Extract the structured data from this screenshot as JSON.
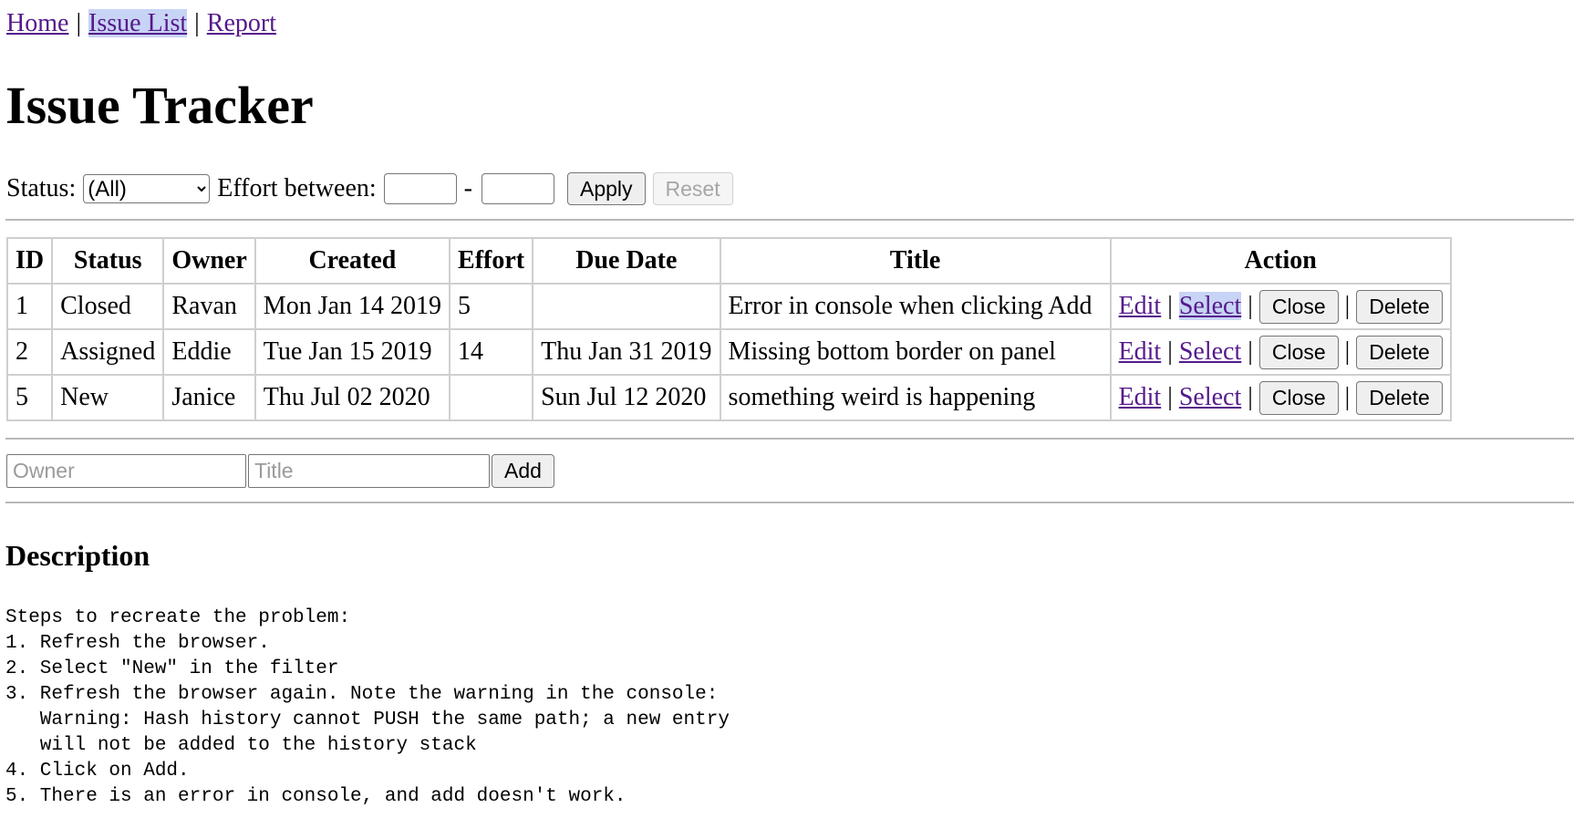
{
  "nav": {
    "home": "Home",
    "separator": "|",
    "issue_list": "Issue List",
    "report": "Report"
  },
  "page_title": "Issue Tracker",
  "filter": {
    "status_label": "Status:",
    "status_selected": "(All)",
    "effort_label": "Effort between:",
    "effort_min": "",
    "effort_max": "",
    "dash": "-",
    "apply_label": "Apply",
    "reset_label": "Reset"
  },
  "table": {
    "headers": [
      "ID",
      "Status",
      "Owner",
      "Created",
      "Effort",
      "Due Date",
      "Title",
      "Action"
    ],
    "rows": [
      {
        "id": "1",
        "status": "Closed",
        "owner": "Ravan",
        "created": "Mon Jan 14 2019",
        "effort": "5",
        "due": "",
        "title": "Error in console when clicking Add"
      },
      {
        "id": "2",
        "status": "Assigned",
        "owner": "Eddie",
        "created": "Tue Jan 15 2019",
        "effort": "14",
        "due": "Thu Jan 31 2019",
        "title": "Missing bottom border on panel"
      },
      {
        "id": "5",
        "status": "New",
        "owner": "Janice",
        "created": "Thu Jul 02 2020",
        "effort": "",
        "due": "Sun Jul 12 2020",
        "title": "something weird is happening"
      }
    ],
    "actions": {
      "edit": "Edit",
      "select": "Select",
      "close": "Close",
      "delete": "Delete",
      "separator": "|"
    }
  },
  "add_form": {
    "owner_placeholder": "Owner",
    "title_placeholder": "Title",
    "add_label": "Add"
  },
  "description": {
    "heading": "Description",
    "text": "Steps to recreate the problem:\n1. Refresh the browser.\n2. Select \"New\" in the filter\n3. Refresh the browser again. Note the warning in the console:\n   Warning: Hash history cannot PUSH the same path; a new entry\n   will not be added to the history stack\n4. Click on Add.\n5. There is an error in console, and add doesn't work."
  }
}
